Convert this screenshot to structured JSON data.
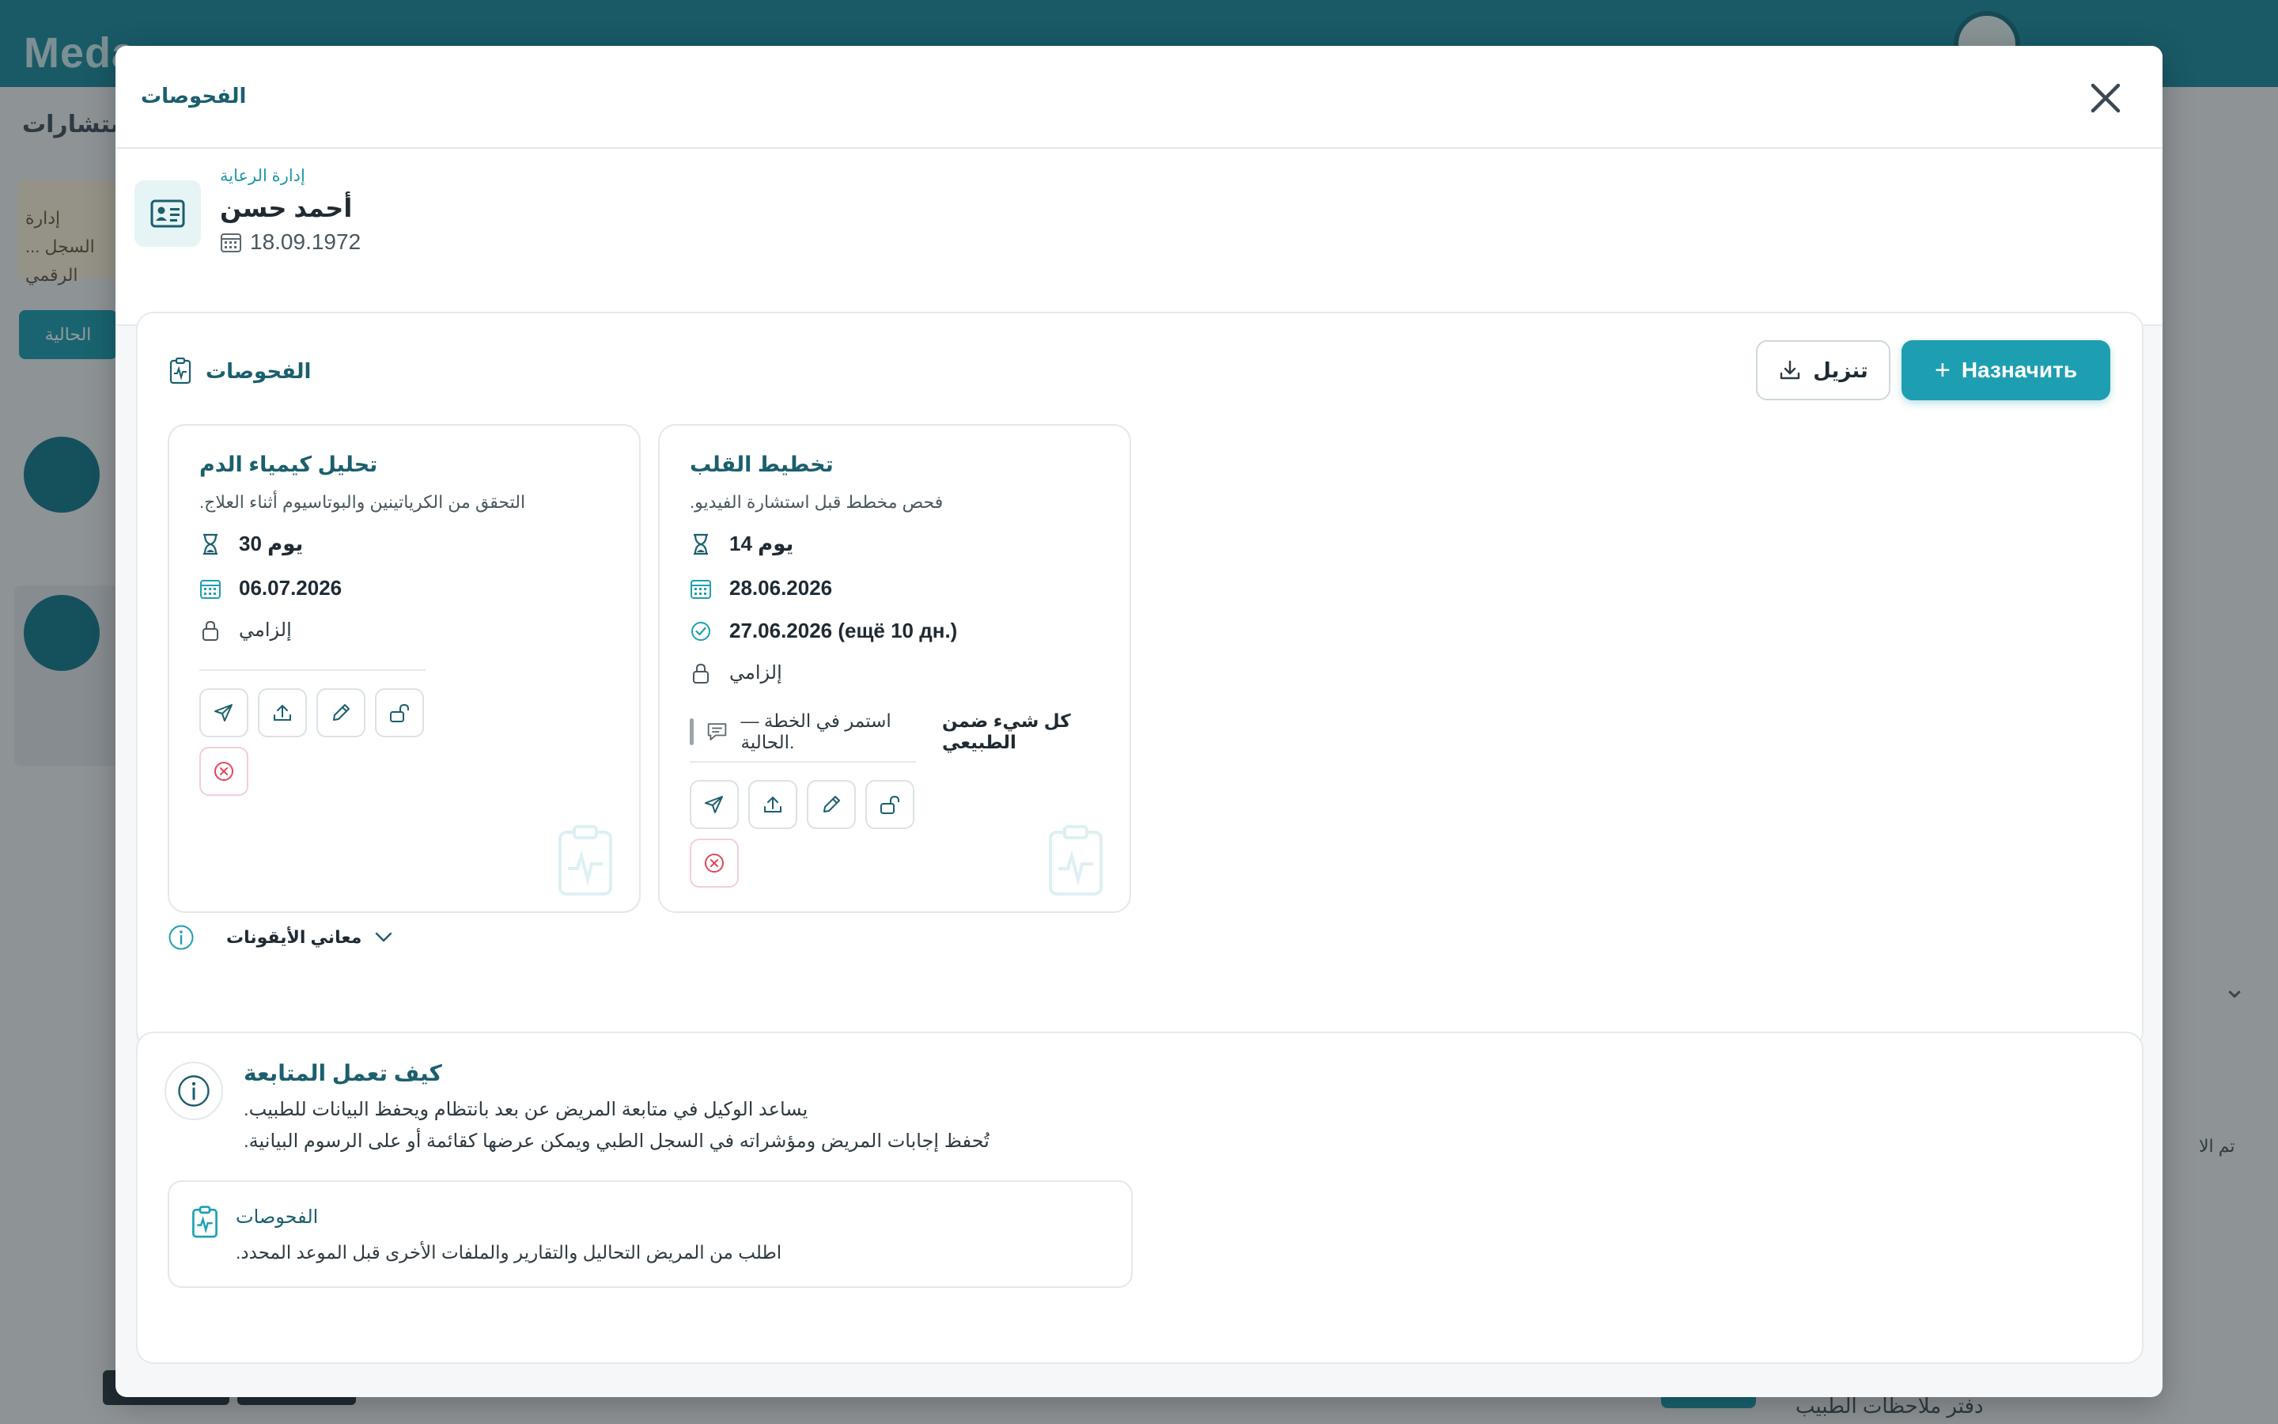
{
  "background": {
    "logo": "Meda",
    "tab": "استشارات",
    "note": "إدارة السجل ... الرقمي",
    "button": "الحالية",
    "bottom_link": "دفتر ملاحظات الطبيب",
    "side_text": "تم الا"
  },
  "modal": {
    "title": "الفحوصات",
    "close_icon": "close-icon"
  },
  "patient": {
    "subtitle": "إدارة الرعاية",
    "name": "أحمد حسن",
    "dob": "18.09.1972",
    "icon": "id-card-icon"
  },
  "exams": {
    "heading": "الفحوصات",
    "download_label": "تنزيل",
    "assign_label": "Назначить",
    "cards": [
      {
        "title": "تحليل كيمياء الدم",
        "description": ".التحقق من الكرياتينين والبوتاسيوم أثناء العلاج",
        "duration": "يوم 30",
        "date": "06.07.2026",
        "requirement": "إلزامي"
      },
      {
        "title": "تخطيط القلب",
        "description": ".فحص مخطط قبل استشارة الفيديو",
        "duration": "يوم 14",
        "date": "28.06.2026",
        "completed": "27.06.2026 (ещё 10 дн.)",
        "requirement": "إلزامي",
        "comment_bold": "كل شيء ضمن الطبيعي",
        "comment_rest": "— استمر في الخطة الحالية."
      }
    ],
    "legend_label": "معاني الأيقونات"
  },
  "how": {
    "title": "كيف تعمل المتابعة",
    "line1": ".يساعد الوكيل في متابعة المريض عن بعد بانتظام ويحفظ البيانات للطبيب",
    "line2": ".تُحفظ إجابات المريض ومؤشراته في السجل الطبي ويمكن عرضها كقائمة أو على الرسوم البيانية",
    "feature_title": "الفحوصات",
    "feature_desc": ".اطلب من المريض التحاليل والتقارير والملفات الأخرى قبل الموعد المحدد"
  },
  "colors": {
    "accent": "#1e9fb1",
    "title": "#1b5f6e",
    "danger": "#e0485a"
  }
}
